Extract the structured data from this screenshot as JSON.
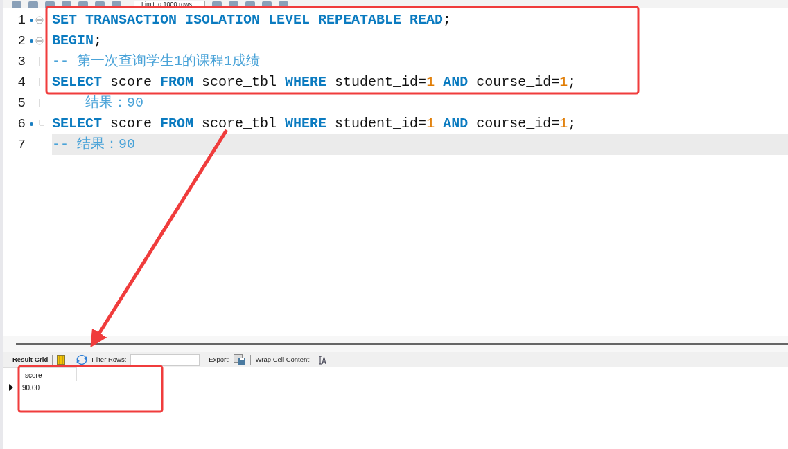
{
  "toolbar": {
    "limit": "Limit to 1000 rows"
  },
  "editor": {
    "lines": [
      {
        "number": "1",
        "marker": true,
        "fold_start": true,
        "fold_end": false,
        "current": false,
        "tokens": [
          {
            "kind": "kw",
            "text": "SET TRANSACTION ISOLATION LEVEL REPEATABLE READ"
          },
          {
            "kind": "id",
            "text": ";"
          }
        ]
      },
      {
        "number": "2",
        "marker": true,
        "fold_start": true,
        "fold_end": false,
        "current": false,
        "tokens": [
          {
            "kind": "kw",
            "text": "BEGIN"
          },
          {
            "kind": "id",
            "text": ";"
          }
        ]
      },
      {
        "number": "3",
        "marker": false,
        "fold_start": false,
        "fold_end": false,
        "current": false,
        "tokens": [
          {
            "kind": "comment",
            "text": "-- 第一次查询学生1的课程1成绩"
          }
        ]
      },
      {
        "number": "4",
        "marker": false,
        "fold_start": false,
        "fold_end": false,
        "current": false,
        "tokens": [
          {
            "kind": "kw",
            "text": "SELECT"
          },
          {
            "kind": "id",
            "text": " score "
          },
          {
            "kind": "kw",
            "text": "FROM"
          },
          {
            "kind": "id",
            "text": " score_tbl "
          },
          {
            "kind": "kw",
            "text": "WHERE"
          },
          {
            "kind": "id",
            "text": " student_id="
          },
          {
            "kind": "num",
            "text": "1"
          },
          {
            "kind": "kw",
            "text": " AND"
          },
          {
            "kind": "id",
            "text": " course_id="
          },
          {
            "kind": "num",
            "text": "1"
          },
          {
            "kind": "id",
            "text": ";"
          }
        ]
      },
      {
        "number": "5",
        "marker": false,
        "fold_start": false,
        "fold_end": false,
        "current": false,
        "tokens": [
          {
            "kind": "comment",
            "text": "    结果：90"
          }
        ]
      },
      {
        "number": "6",
        "marker": true,
        "fold_start": false,
        "fold_end": true,
        "current": false,
        "tokens": [
          {
            "kind": "kw",
            "text": "SELECT"
          },
          {
            "kind": "id",
            "text": " score "
          },
          {
            "kind": "kw",
            "text": "FROM"
          },
          {
            "kind": "id",
            "text": " score_tbl "
          },
          {
            "kind": "kw",
            "text": "WHERE"
          },
          {
            "kind": "id",
            "text": " student_id="
          },
          {
            "kind": "num",
            "text": "1"
          },
          {
            "kind": "kw",
            "text": " AND"
          },
          {
            "kind": "id",
            "text": " course_id="
          },
          {
            "kind": "num",
            "text": "1"
          },
          {
            "kind": "id",
            "text": ";"
          }
        ]
      },
      {
        "number": "7",
        "marker": false,
        "fold_start": false,
        "fold_end": false,
        "current": true,
        "tokens": [
          {
            "kind": "comment",
            "text": "-- 结果：90"
          }
        ]
      }
    ]
  },
  "result": {
    "tab": "Result Grid",
    "filter_label": "Filter Rows:",
    "export_label": "Export:",
    "wrap_label": "Wrap Cell Content:",
    "columns": [
      "score"
    ],
    "rows": [
      {
        "selected": true,
        "cells": [
          "90.00"
        ]
      }
    ]
  }
}
